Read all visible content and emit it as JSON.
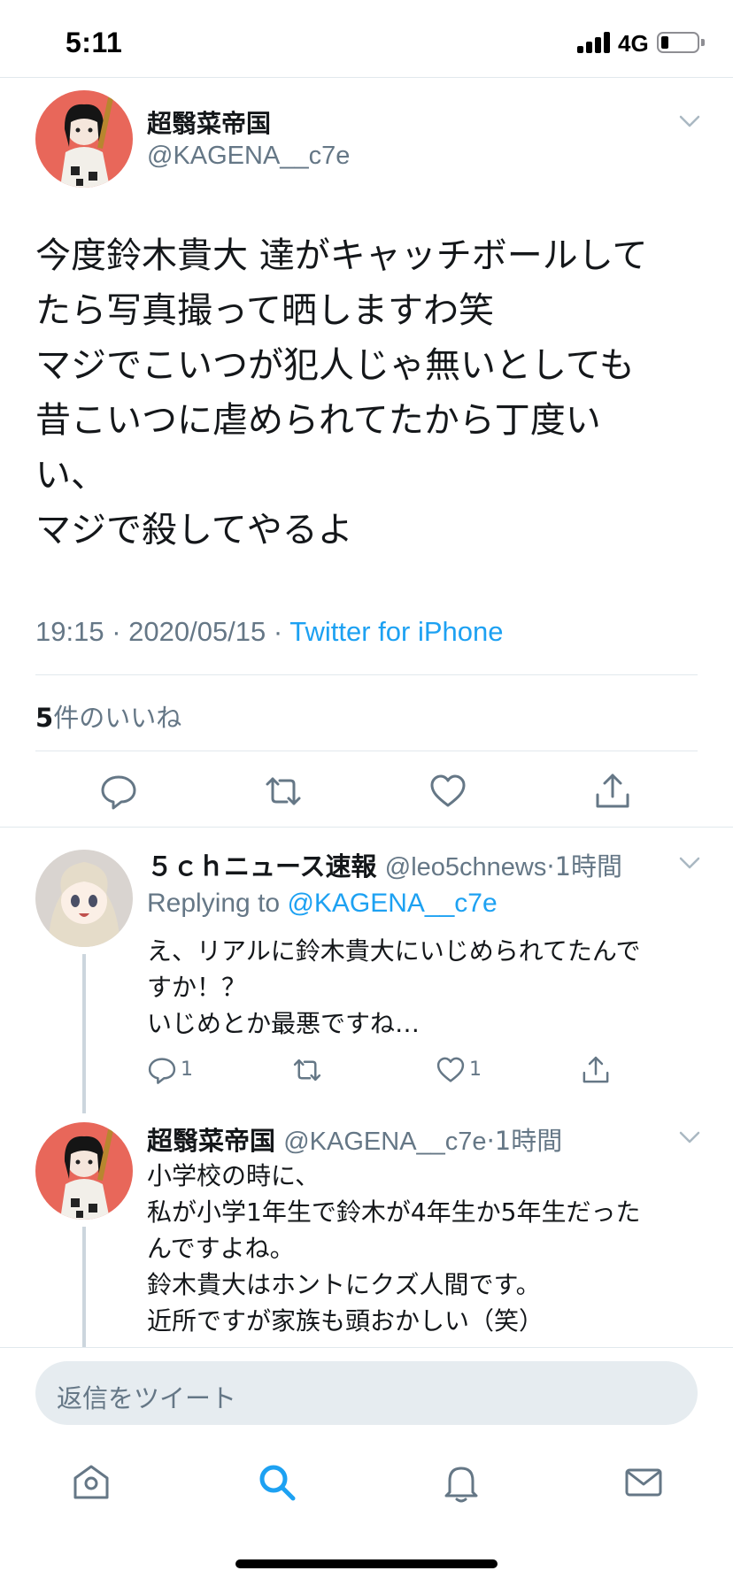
{
  "status_bar": {
    "time": "5:11",
    "network": "4G",
    "battery_level": 0.15
  },
  "main_tweet": {
    "display_name": "超翳菜帝国",
    "handle": "@KAGENA__c7e",
    "lines": [
      "今度鈴木貴大 達がキャッチボールして",
      "たら写真撮って晒しますわ笑",
      "マジでこいつが犯人じゃ無いとしても",
      "昔こいつに虐められてたから丁度い",
      "い、",
      "マジで殺してやるよ"
    ],
    "timestamp": "19:15 · 2020/05/15 · ",
    "source": "Twitter for iPhone",
    "like_count": "5",
    "like_label": "件のいいね"
  },
  "actions": {
    "reply_icon": "reply-icon",
    "retweet_icon": "retweet-icon",
    "like_icon": "heart-icon",
    "share_icon": "share-icon"
  },
  "replies": [
    {
      "display_name": "５ｃｈニュース速報",
      "handle": "@leo5chnews",
      "time": "·1時間",
      "replying_prefix": "Replying to ",
      "replying_to": "@KAGENA__c7e",
      "lines": [
        "え、リアルに鈴木貴大にいじめられてたんで",
        "すか！？",
        "いじめとか最悪ですね…"
      ],
      "reply_count": "1",
      "like_count": "1"
    },
    {
      "display_name": "超翳菜帝国",
      "handle": "@KAGENA__c7e",
      "time": "·1時間",
      "lines": [
        "小学校の時に、",
        "私が小学1年生で鈴木が4年生か5年生だった",
        "んですよね。",
        "鈴木貴大はホントにクズ人間です。",
        "近所ですが家族も頭おかしい（笑）"
      ]
    }
  ],
  "composer": {
    "placeholder": "返信をツイート"
  },
  "tab_bar": {
    "tabs": [
      "home-icon",
      "search-icon",
      "bell-icon",
      "mail-icon"
    ],
    "active": "search-icon"
  },
  "colors": {
    "accent": "#1da1f2",
    "secondary_text": "#657786",
    "avatar_bg": "#e8675a"
  }
}
